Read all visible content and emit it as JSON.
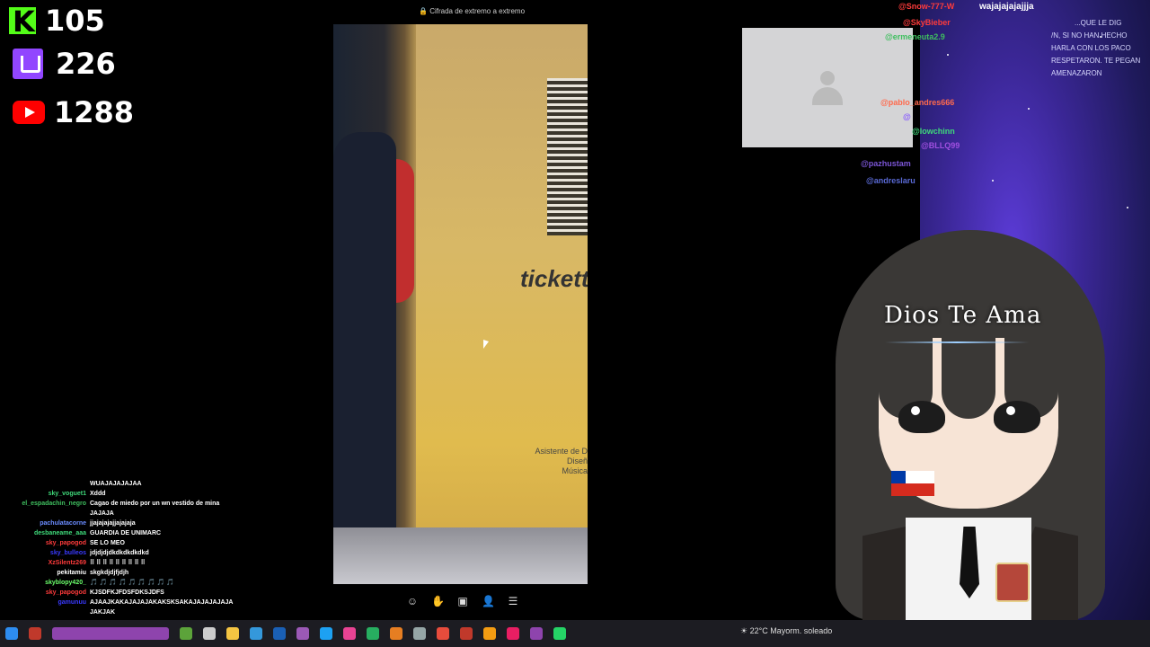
{
  "counters": {
    "kick": "105",
    "twitch": "226",
    "youtube": "1288"
  },
  "call": {
    "encryption_label": "Cifrada de extremo a extremo",
    "video_text": {
      "brand": "tickett",
      "sign": "Asistente de D\nDiseñ\nMúsica"
    }
  },
  "overlay_text": "Dios Te Ama",
  "right_chat": {
    "top_user": "@Snow-777-W",
    "top_msg": "wajajajajajjja",
    "mentions": [
      {
        "name": "@SkyBieber",
        "color": "#ff3b3b"
      },
      {
        "name": "@ermeneuta2.9",
        "color": "#3fbf5f"
      },
      {
        "name": "@pablo_andres666",
        "color": "#ff6a4d"
      },
      {
        "name": "@",
        "color": "#8a5cff"
      },
      {
        "name": "@lowchinn",
        "color": "#3fd97a"
      },
      {
        "name": "@BLLQ99",
        "color": "#a04fe0"
      },
      {
        "name": "@pazhustam",
        "color": "#7b55d6"
      },
      {
        "name": "@andreslaru",
        "color": "#5a6ad6"
      }
    ],
    "message_lines": [
      "...QUE LE DIG",
      "/N, SI NO HAN HECHO",
      "HARLA CON LOS PACO",
      "RESPETARON. TE PEGAN",
      "AMENAZARON"
    ]
  },
  "left_chat": [
    {
      "user": "",
      "color": "#3a3aff",
      "msg": "WUAJAJAJAJAA"
    },
    {
      "user": "sky_voguet1",
      "color": "#3fd97a",
      "msg": "Xddd"
    },
    {
      "user": "el_espadachin_negro",
      "color": "#3fbf5f",
      "msg": "Cagao de miedo por un wn vestido de mina JAJAJA"
    },
    {
      "user": "pachulatacorne",
      "color": "#6b8cff",
      "msg": "jjajajajajjajajaja"
    },
    {
      "user": "desbaneame_aaa",
      "color": "#3fd97a",
      "msg": "GUARDIA DE UNIMARC"
    },
    {
      "user": "sky_papogod",
      "color": "#ff3b3b",
      "msg": "SE LO MEO"
    },
    {
      "user": "sky_bulleos",
      "color": "#3a3aff",
      "msg": "jdjdjdjdkdkdkdkdkd"
    },
    {
      "user": "XzSilentz269",
      "color": "#ff3b3b",
      "msg": "⠿ ⠿ ⠿ ⠿ ⠿ ⠿ ⠿ ⠿ ⠿"
    },
    {
      "user": "pekitamiu",
      "color": "#fff",
      "msg": "skgkdjdjfjdjh"
    },
    {
      "user": "skyblopy420_",
      "color": "#6bff6b",
      "msg": "🎵 🎵 🎵 🎵 🎵 🎵 🎵 🎵 🎵"
    },
    {
      "user": "sky_papogod",
      "color": "#ff3b3b",
      "msg": "KJSDFKJFDSFDKSJDFS"
    },
    {
      "user": "gamunuu",
      "color": "#3a3aff",
      "msg": "AJAAJKAKAJAJAJAKAKSKSAKAJAJAJAJAJA JAKJAK"
    }
  ],
  "weather": {
    "text": "22°C  Mayorm. soleado"
  },
  "colors": {
    "kick": "#53fc18",
    "twitch": "#9146ff",
    "youtube": "#ff0000",
    "taskbar": "#1c1c22"
  }
}
